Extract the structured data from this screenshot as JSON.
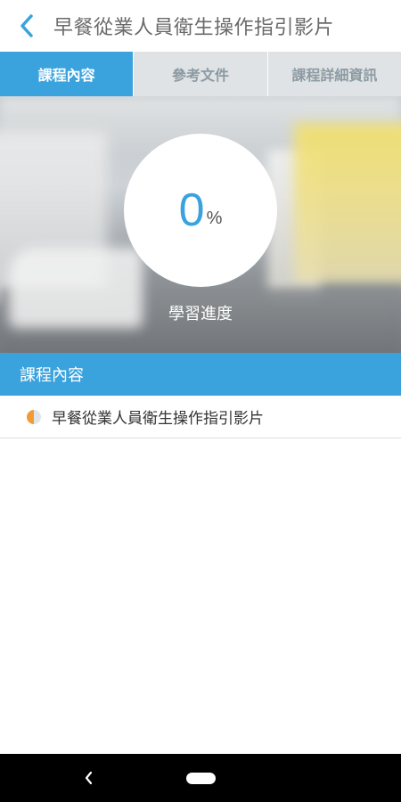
{
  "header": {
    "title": "早餐從業人員衛生操作指引影片",
    "back_icon": "chevron-left-icon"
  },
  "tabs": [
    {
      "label": "課程內容",
      "active": true
    },
    {
      "label": "參考文件",
      "active": false
    },
    {
      "label": "課程詳細資訊",
      "active": false
    }
  ],
  "progress": {
    "value": "0",
    "unit": "%",
    "label": "學習進度"
  },
  "section": {
    "title": "課程內容"
  },
  "course_items": [
    {
      "name": "早餐從業人員衛生操作指引影片",
      "status_icon": "half-progress-icon"
    }
  ],
  "navbar": {
    "back_icon": "nav-back-icon",
    "home_icon": "nav-home-pill"
  },
  "colors": {
    "accent": "#3aa3de",
    "tab_inactive_bg": "#dfe3e5",
    "status_orange": "#f29a38"
  }
}
